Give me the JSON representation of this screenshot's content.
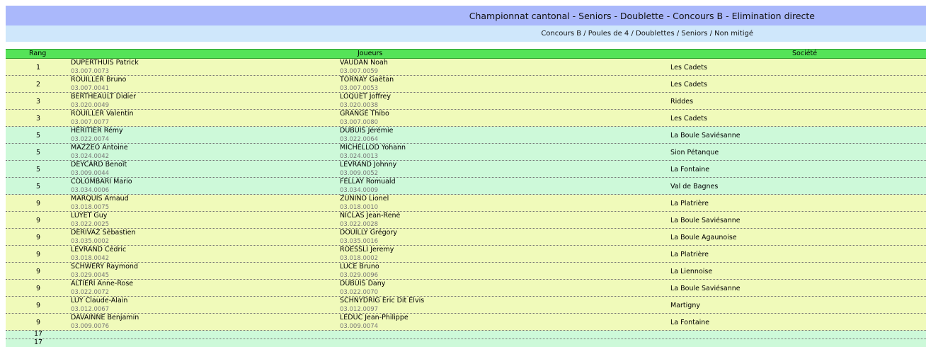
{
  "header": {
    "title": "Championnat cantonal - Seniors - Doublette - Concours B - Elimination directe",
    "subtitle": "Concours B / Poules de 4 / Doublettes / Seniors / Non mitigé"
  },
  "columns": {
    "rang": "Rang",
    "joueurs": "Joueurs",
    "societe": "Société"
  },
  "rows": [
    {
      "rang": "1",
      "p1": "DUPERTHUIS Patrick",
      "l1": "03.007.0073",
      "p2": "VAUDAN Noah",
      "l2": "03.007.0059",
      "soc": "Les Cadets"
    },
    {
      "rang": "2",
      "p1": "ROUILLER Bruno",
      "l1": "03.007.0041",
      "p2": "TORNAY Gaëtan",
      "l2": "03.007.0053",
      "soc": "Les Cadets"
    },
    {
      "rang": "3",
      "p1": "BERTHEAULT Didier",
      "l1": "03.020.0049",
      "p2": "LOQUET Joffrey",
      "l2": "03.020.0038",
      "soc": "Riddes"
    },
    {
      "rang": "3",
      "p1": "ROUILLER Valentin",
      "l1": "03.007.0077",
      "p2": "GRANGE Thibo",
      "l2": "03.007.0080",
      "soc": "Les Cadets"
    },
    {
      "rang": "5",
      "p1": "HÉRITIER Rémy",
      "l1": "03.022.0074",
      "p2": "DUBUIS Jérémie",
      "l2": "03.022.0064",
      "soc": "La Boule Saviésanne"
    },
    {
      "rang": "5",
      "p1": "MAZZEO Antoine",
      "l1": "03.024.0042",
      "p2": "MICHELLOD Yohann",
      "l2": "03.024.0013",
      "soc": "Sion Pétanque"
    },
    {
      "rang": "5",
      "p1": "DEYCARD Benoît",
      "l1": "03.009.0044",
      "p2": "LEVRAND Johnny",
      "l2": "03.009.0052",
      "soc": "La Fontaine"
    },
    {
      "rang": "5",
      "p1": "COLOMBARI Mario",
      "l1": "03.034.0006",
      "p2": "FELLAY Romuald",
      "l2": "03.034.0009",
      "soc": "Val de Bagnes"
    },
    {
      "rang": "9",
      "p1": "MARQUIS Arnaud",
      "l1": "03.018.0075",
      "p2": "ZUNINO Lionel",
      "l2": "03.018.0010",
      "soc": "La Platrière"
    },
    {
      "rang": "9",
      "p1": "LUYET Guy",
      "l1": "03.022.0025",
      "p2": "NICLAS Jean-René",
      "l2": "03.022.0028",
      "soc": "La Boule Saviésanne"
    },
    {
      "rang": "9",
      "p1": "DERIVAZ Sébastien",
      "l1": "03.035.0002",
      "p2": "DOUILLY Grégory",
      "l2": "03.035.0016",
      "soc": "La Boule Agaunoise"
    },
    {
      "rang": "9",
      "p1": "LEVRAND Cédric",
      "l1": "03.018.0042",
      "p2": "ROESSLI Jeremy",
      "l2": "03.018.0002",
      "soc": "La Platrière"
    },
    {
      "rang": "9",
      "p1": "SCHWERY Raymond",
      "l1": "03.029.0045",
      "p2": "LUCE Bruno",
      "l2": "03.029.0096",
      "soc": "La Liennoise"
    },
    {
      "rang": "9",
      "p1": "ALTIERI Anne-Rose",
      "l1": "03.022.0072",
      "p2": "DUBUIS Dany",
      "l2": "03.022.0070",
      "soc": "La Boule Saviésanne"
    },
    {
      "rang": "9",
      "p1": "LUY Claude-Alain",
      "l1": "03.012.0067",
      "p2": "SCHNYDRIG Eric Dit Elvis",
      "l2": "03.012.0097",
      "soc": "Martigny"
    },
    {
      "rang": "9",
      "p1": "DAVAINNE Benjamin",
      "l1": "03.009.0076",
      "p2": "LEDUC Jean-Philippe",
      "l2": "03.009.0074",
      "soc": "La Fontaine"
    },
    {
      "rang": "17",
      "p1": "",
      "l1": "",
      "p2": "",
      "l2": "",
      "soc": ""
    },
    {
      "rang": "17",
      "p1": "",
      "l1": "",
      "p2": "",
      "l2": "",
      "soc": ""
    }
  ],
  "colors": {
    "title_bg": "#aab8fb",
    "sub_bg": "#cfe7fb",
    "header_bg": "#55e358",
    "row_yellow": "#f0faba",
    "row_green": "#cdf9d9"
  }
}
